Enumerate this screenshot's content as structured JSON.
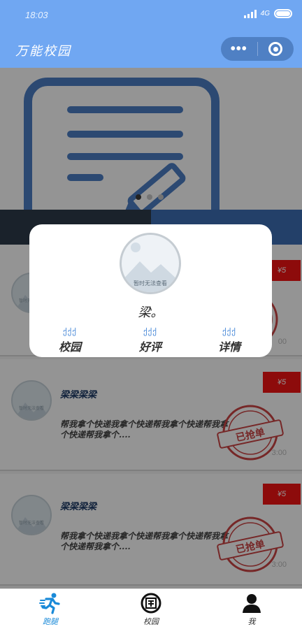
{
  "status_bar": {
    "time": "18:03",
    "network": "4G"
  },
  "nav": {
    "title": "万能校园",
    "more_icon": "more-dots-icon",
    "close_icon": "target-close-icon"
  },
  "banner": {
    "icon": "note-pencil-icon",
    "page_index": 0,
    "page_count": 3
  },
  "orders": [
    {
      "name": "",
      "desc": "",
      "price": "¥5",
      "stamp": "已抢单",
      "time": "00",
      "avatar_caption": "暂时无法查看"
    },
    {
      "name": "梁梁梁梁",
      "desc": "帮我拿个快递我拿个快递帮我拿个快递帮我拿个快递帮我拿个....",
      "price": "¥5",
      "stamp": "已抢单",
      "time": "3:00",
      "avatar_caption": "暂时无法查看"
    },
    {
      "name": "梁梁梁梁",
      "desc": "帮我拿个快递我拿个快递帮我拿个快递帮我拿个快递帮我拿个....",
      "price": "¥5",
      "stamp": "已抢单",
      "time": "3:00",
      "avatar_caption": "暂时无法查看"
    }
  ],
  "modal": {
    "avatar_caption": "暂时无法查看",
    "name": "梁。",
    "actions": [
      {
        "deco": "ქქქ",
        "label": "校园"
      },
      {
        "deco": "ქქქ",
        "label": "好评"
      },
      {
        "deco": "ქქქ",
        "label": "详情"
      }
    ]
  },
  "tabbar": {
    "items": [
      {
        "label": "跑腿",
        "icon": "runner-icon",
        "active": true
      },
      {
        "label": "校园",
        "icon": "campus-badge-icon",
        "active": false
      },
      {
        "label": "我",
        "icon": "person-icon",
        "active": false
      }
    ]
  },
  "colors": {
    "nav_bg": "#70a7f2",
    "capsule_bg": "#4f80c4",
    "price_bg": "#f31414",
    "tab_active": "#1a8ad8"
  }
}
